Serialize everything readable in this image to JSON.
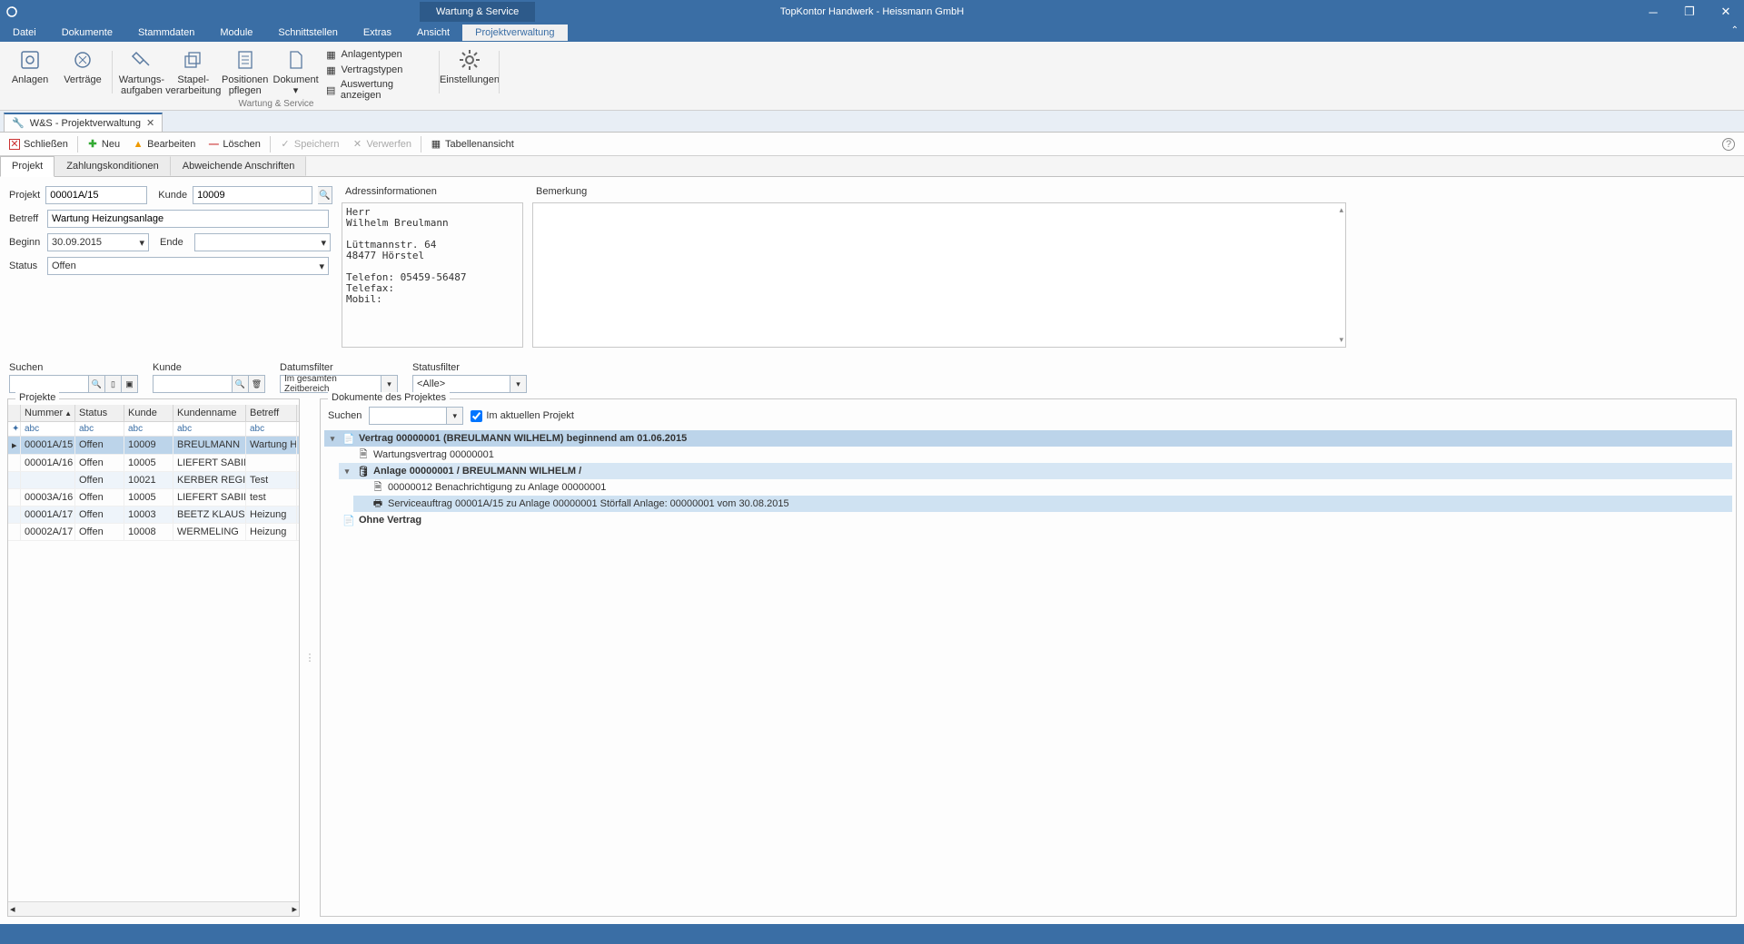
{
  "title_context": "Wartung & Service",
  "app_title": "TopKontor Handwerk -  Heissmann GmbH",
  "menu": [
    "Datei",
    "Dokumente",
    "Stammdaten",
    "Module",
    "Schnittstellen",
    "Extras",
    "Ansicht",
    "Projektverwaltung"
  ],
  "menu_active_index": 7,
  "ribbon": {
    "large": [
      {
        "label": "Anlagen"
      },
      {
        "label": "Verträge"
      },
      {
        "label": "Wartungs-\naufgaben"
      },
      {
        "label": "Stapel-\nverarbeitung"
      },
      {
        "label": "Positionen\npflegen"
      },
      {
        "label": "Dokument\n▾"
      }
    ],
    "small": [
      "Anlagentypen",
      "Vertragstypen",
      "Auswertung anzeigen"
    ],
    "settings": "Einstellungen",
    "group_label": "Wartung & Service"
  },
  "doc_tab": "W&S - Projektverwaltung",
  "toolbar": {
    "close": "Schließen",
    "new": "Neu",
    "edit": "Bearbeiten",
    "delete": "Löschen",
    "save": "Speichern",
    "discard": "Verwerfen",
    "tableview": "Tabellenansicht"
  },
  "inner_tabs": [
    "Projekt",
    "Zahlungskonditionen",
    "Abweichende Anschriften"
  ],
  "form": {
    "projekt_label": "Projekt",
    "projekt": "00001A/15",
    "kunde_label": "Kunde",
    "kunde": "10009",
    "betreff_label": "Betreff",
    "betreff": "Wartung Heizungsanlage",
    "beginn_label": "Beginn",
    "beginn": "30.09.2015",
    "ende_label": "Ende",
    "ende": "",
    "status_label": "Status",
    "status": "Offen",
    "address_title": "Adressinformationen",
    "address": "Herr\nWilhelm Breulmann\n\nLüttmannstr. 64\n48477 Hörstel\n\nTelefon: 05459-56487\nTelefax:\nMobil:",
    "remark_title": "Bemerkung"
  },
  "filters": {
    "suchen": "Suchen",
    "kunde": "Kunde",
    "datum": "Datumsfilter",
    "status": "Statusfilter",
    "datum_val": "Im gesamten Zeitbereich",
    "status_val": "<Alle>"
  },
  "left_panel_title": "Projekte",
  "grid": {
    "headers": [
      "Nummer",
      "Status",
      "Kunde",
      "Kundenname",
      "Betreff"
    ],
    "filter_token": "abc",
    "rows": [
      {
        "num": "00001A/15",
        "status": "Offen",
        "kunde": "10009",
        "name": "BREULMANN",
        "betreff": "Wartung He",
        "sel": true
      },
      {
        "num": "00001A/16",
        "status": "Offen",
        "kunde": "10005",
        "name": "LIEFERT SABINE",
        "betreff": ""
      },
      {
        "num": "",
        "status": "Offen",
        "kunde": "10021",
        "name": "KERBER REGINA",
        "betreff": "Test",
        "alt": true
      },
      {
        "num": "00003A/16",
        "status": "Offen",
        "kunde": "10005",
        "name": "LIEFERT SABINE",
        "betreff": "test"
      },
      {
        "num": "00001A/17",
        "status": "Offen",
        "kunde": "10003",
        "name": "BEETZ KLAUS",
        "betreff": "Heizung",
        "alt": true
      },
      {
        "num": "00002A/17",
        "status": "Offen",
        "kunde": "10008",
        "name": "WERMELING",
        "betreff": "Heizung"
      }
    ]
  },
  "right_panel_title": "Dokumente des Projektes",
  "right_search_label": "Suchen",
  "right_checkbox": "Im aktuellen Projekt",
  "tree": [
    {
      "level": 0,
      "exp": "▾",
      "icon": "contract",
      "text": "Vertrag 00000001 (BREULMANN WILHELM) beginnend am 01.06.2015",
      "cls": "h1"
    },
    {
      "level": 1,
      "exp": "",
      "icon": "doc",
      "text": "Wartungsvertrag 00000001"
    },
    {
      "level": 1,
      "exp": "▾",
      "icon": "anlage",
      "text": "Anlage 00000001 / BREULMANN WILHELM /",
      "cls": "h2"
    },
    {
      "level": 2,
      "exp": "",
      "icon": "doc",
      "text": "00000012 Benachrichtigung zu Anlage 00000001"
    },
    {
      "level": 2,
      "exp": "",
      "icon": "print",
      "text": "Serviceauftrag 00001A/15 zu Anlage 00000001 Störfall Anlage: 00000001 vom 30.08.2015",
      "cls": "sel"
    },
    {
      "level": 0,
      "exp": "",
      "icon": "contract",
      "text": "Ohne Vertrag",
      "bold": true
    }
  ]
}
